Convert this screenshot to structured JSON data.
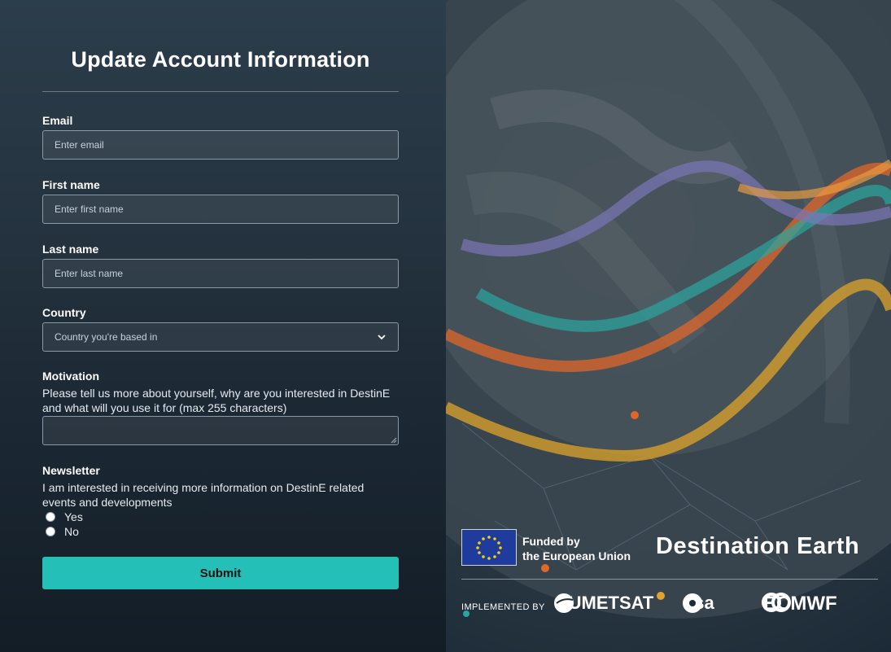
{
  "form": {
    "title": "Update Account Information",
    "email": {
      "label": "Email",
      "placeholder": "Enter email"
    },
    "first_name": {
      "label": "First name",
      "placeholder": "Enter first name"
    },
    "last_name": {
      "label": "Last name",
      "placeholder": "Enter last name"
    },
    "country": {
      "label": "Country",
      "selected": "Country you're based in"
    },
    "motivation": {
      "label": "Motivation",
      "help": "Please tell us more about yourself, why are you interested in DestinE and what will you use it for (max 255 characters)"
    },
    "newsletter": {
      "label": "Newsletter",
      "help": "I am interested in receiving more information on DestinE related events and developments",
      "options": [
        {
          "label": "Yes"
        },
        {
          "label": "No"
        }
      ]
    },
    "submit_label": "Submit"
  },
  "branding": {
    "funded_line1": "Funded by",
    "funded_line2": "the European Union",
    "destination_earth": "Destination Earth",
    "implemented_by": "IMPLEMENTED BY",
    "partners": [
      "EUMETSAT",
      "esa",
      "ECMWF"
    ]
  },
  "colors": {
    "accent": "#24c0b8",
    "panel_bg": "#24333f",
    "wave_orange": "#e0662a",
    "wave_teal": "#2aa6a0",
    "wave_purple": "#7a76b8",
    "wave_yellow": "#e0a42a"
  },
  "icons": {
    "select_arrow": "chevron-down-icon",
    "eu_flag": "eu-flag-icon"
  }
}
